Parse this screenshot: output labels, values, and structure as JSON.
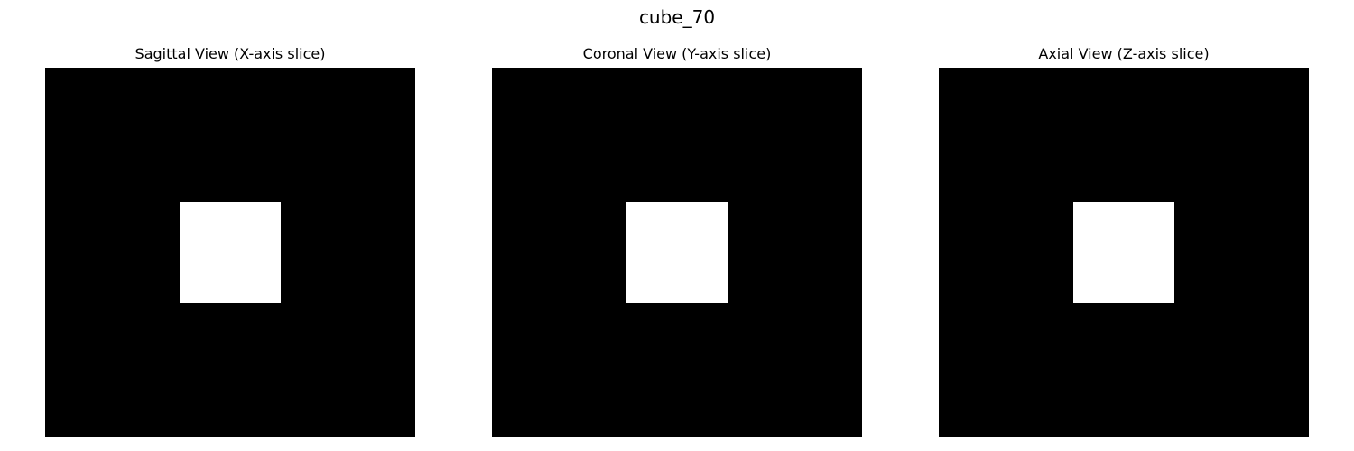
{
  "figure": {
    "title": "cube_70",
    "panels": [
      {
        "title": "Sagittal View (X-axis slice)"
      },
      {
        "title": "Coronal View (Y-axis slice)"
      },
      {
        "title": "Axial View (Z-axis slice)"
      }
    ]
  },
  "colors": {
    "background": "#000000",
    "cube": "#ffffff"
  }
}
